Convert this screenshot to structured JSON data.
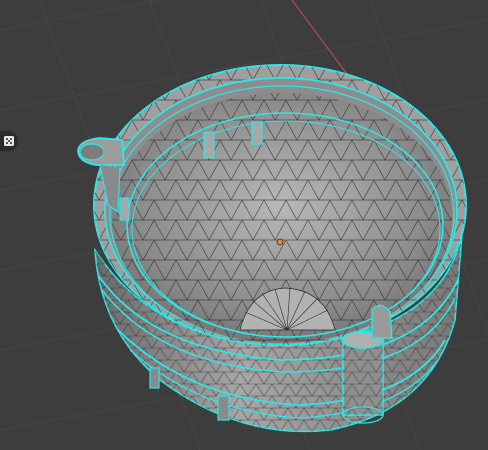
{
  "viewport": {
    "background": "#3d3d3d",
    "grid_color": "#474747",
    "axis_color": "#b34a57",
    "mesh": {
      "name": "bowl-mesh",
      "fill": "#9a9a9a",
      "inner_fill": "#8e8e8e",
      "wire_color": "#2a2a2a",
      "selected_edge_color": "#2ee6e6",
      "origin_color": "#e08a2a"
    }
  },
  "toolbar": {
    "tool_icon": "dice-icon"
  }
}
